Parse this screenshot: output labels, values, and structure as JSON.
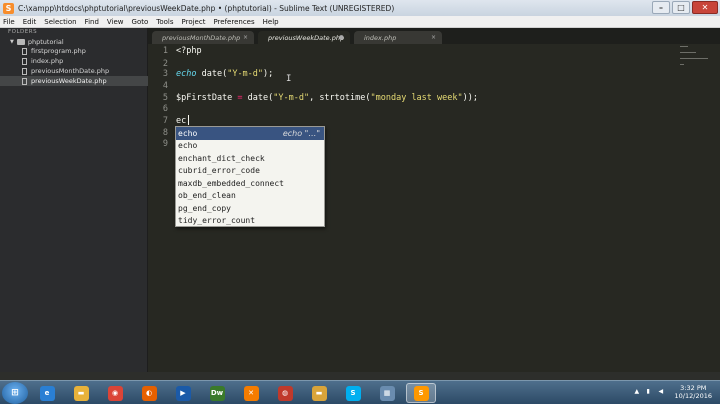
{
  "window": {
    "title": "C:\\xampp\\htdocs\\phptutorial\\previousWeekDate.php • (phptutorial) - Sublime Text (UNREGISTERED)",
    "app_icon": "sublime-text-icon",
    "controls": {
      "minimize": "–",
      "maximize": "□",
      "close": "✕"
    }
  },
  "menu": {
    "items": [
      "File",
      "Edit",
      "Selection",
      "Find",
      "View",
      "Goto",
      "Tools",
      "Project",
      "Preferences",
      "Help"
    ]
  },
  "sidebar": {
    "header": "FOLDERS",
    "folder": "phptutorial",
    "files": [
      {
        "name": "firstprogram.php",
        "active": false
      },
      {
        "name": "index.php",
        "active": false
      },
      {
        "name": "previousMonthDate.php",
        "active": false
      },
      {
        "name": "previousWeekDate.php",
        "active": true
      }
    ]
  },
  "tabs": [
    {
      "label": "previousMonthDate.php",
      "active": false,
      "close": "×"
    },
    {
      "label": "previousWeekDate.php",
      "active": true,
      "close": "●"
    },
    {
      "label": "index.php",
      "active": false,
      "close": "×"
    }
  ],
  "editor": {
    "line_numbers": [
      "1",
      "2",
      "3",
      "4",
      "5",
      "6",
      "7",
      "8",
      "9"
    ],
    "lines": {
      "l1": "<?php",
      "l3_kw": "echo",
      "l3_fn": " date(",
      "l3_str": "\"Y-m-d\"",
      "l3_end": ");",
      "l5_var": "$pFirstDate",
      "l5_op": " = ",
      "l5_fn": "date(",
      "l5_str1": "\"Y-m-d\"",
      "l5_mid": ", strtotime(",
      "l5_str2": "\"monday last week\"",
      "l5_end": "));",
      "l7": "ec"
    }
  },
  "autocomplete": {
    "items": [
      {
        "label": "echo",
        "hint": "echo \"…\"",
        "selected": true
      },
      {
        "label": "echo",
        "hint": "",
        "selected": false
      },
      {
        "label": "enchant_dict_check",
        "hint": "",
        "selected": false
      },
      {
        "label": "cubrid_error_code",
        "hint": "",
        "selected": false
      },
      {
        "label": "maxdb_embedded_connect",
        "hint": "",
        "selected": false
      },
      {
        "label": "ob_end_clean",
        "hint": "",
        "selected": false
      },
      {
        "label": "pg_end_copy",
        "hint": "",
        "selected": false
      },
      {
        "label": "tidy_error_count",
        "hint": "",
        "selected": false
      }
    ]
  },
  "taskbar": {
    "start_label": "⊞",
    "apps": [
      {
        "icon": "ie-icon",
        "glyph": "e",
        "color": "#2a7fd4"
      },
      {
        "icon": "folder-icon",
        "glyph": "▬",
        "color": "#e8b23a"
      },
      {
        "icon": "chrome-icon",
        "glyph": "◉",
        "color": "#db4437"
      },
      {
        "icon": "firefox-icon",
        "glyph": "◐",
        "color": "#e66000"
      },
      {
        "icon": "media-icon",
        "glyph": "▶",
        "color": "#1b5aa8"
      },
      {
        "icon": "dreamweaver-icon",
        "glyph": "Dw",
        "color": "#3a7a2a"
      },
      {
        "icon": "xampp-icon",
        "glyph": "✕",
        "color": "#f57c00"
      },
      {
        "icon": "paint-icon",
        "glyph": "◍",
        "color": "#c0392b"
      },
      {
        "icon": "folder2-icon",
        "glyph": "▬",
        "color": "#d9a43a"
      },
      {
        "icon": "skype-icon",
        "glyph": "S",
        "color": "#00aff0"
      },
      {
        "icon": "explorer-icon",
        "glyph": "▦",
        "color": "#6a8caf"
      },
      {
        "icon": "sublime-icon",
        "glyph": "S",
        "color": "#ff9800",
        "active": true
      }
    ],
    "clock_time": "3:32 PM",
    "clock_date": "10/12/2016"
  }
}
